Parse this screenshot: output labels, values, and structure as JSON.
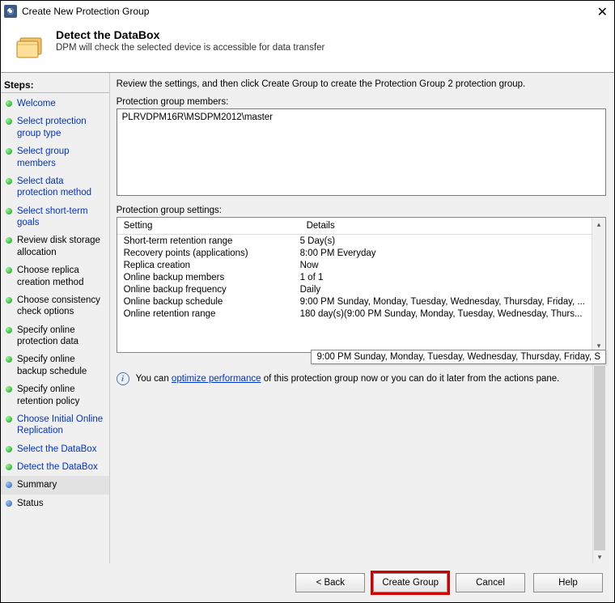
{
  "window": {
    "title": "Create New Protection Group"
  },
  "header": {
    "title": "Detect the DataBox",
    "subtitle": "DPM will check the selected device is accessible for data transfer"
  },
  "sidebar": {
    "heading": "Steps:",
    "items": [
      {
        "label": "Welcome",
        "state": "done",
        "link": true
      },
      {
        "label": "Select protection group type",
        "state": "done",
        "link": true
      },
      {
        "label": "Select group members",
        "state": "done",
        "link": true
      },
      {
        "label": "Select data protection method",
        "state": "done",
        "link": true
      },
      {
        "label": "Select short-term goals",
        "state": "done",
        "link": true
      },
      {
        "label": "Review disk storage allocation",
        "state": "done",
        "link": false
      },
      {
        "label": "Choose replica creation method",
        "state": "done",
        "link": false
      },
      {
        "label": "Choose consistency check options",
        "state": "done",
        "link": false
      },
      {
        "label": "Specify online protection data",
        "state": "done",
        "link": false
      },
      {
        "label": "Specify online backup schedule",
        "state": "done",
        "link": false
      },
      {
        "label": "Specify online retention policy",
        "state": "done",
        "link": false
      },
      {
        "label": "Choose Initial Online Replication",
        "state": "done",
        "link": true
      },
      {
        "label": "Select the DataBox",
        "state": "done",
        "link": true
      },
      {
        "label": "Detect the DataBox",
        "state": "done",
        "link": true
      },
      {
        "label": "Summary",
        "state": "pending",
        "link": false,
        "current": true
      },
      {
        "label": "Status",
        "state": "pending",
        "link": false
      }
    ]
  },
  "main": {
    "instruction": "Review the settings, and then click Create Group to create the Protection Group 2 protection group.",
    "members_label": "Protection group members:",
    "members_value": "PLRVDPM16R\\MSDPM2012\\master",
    "settings_label": "Protection group settings:",
    "settings_columns": {
      "setting": "Setting",
      "details": "Details"
    },
    "settings_rows": [
      {
        "setting": "Short-term retention range",
        "details": "5 Day(s)"
      },
      {
        "setting": "Recovery points (applications)",
        "details": "8:00 PM Everyday"
      },
      {
        "setting": "Replica creation",
        "details": "Now"
      },
      {
        "setting": "Online backup members",
        "details": "1 of 1"
      },
      {
        "setting": "Online backup frequency",
        "details": "Daily"
      },
      {
        "setting": "Online backup schedule",
        "details": "9:00 PM Sunday, Monday, Tuesday, Wednesday, Thursday, Friday, ..."
      },
      {
        "setting": "Online retention range",
        "details": "180 day(s)(9:00 PM Sunday, Monday, Tuesday, Wednesday, Thurs..."
      }
    ],
    "tooltip": "9:00 PM Sunday, Monday, Tuesday, Wednesday, Thursday, Friday, S",
    "optimize_prefix": "You can ",
    "optimize_link": "optimize performance",
    "optimize_suffix": " of this protection group now or you can do it later from the actions pane."
  },
  "footer": {
    "back": "< Back",
    "create": "Create Group",
    "cancel": "Cancel",
    "help": "Help"
  }
}
